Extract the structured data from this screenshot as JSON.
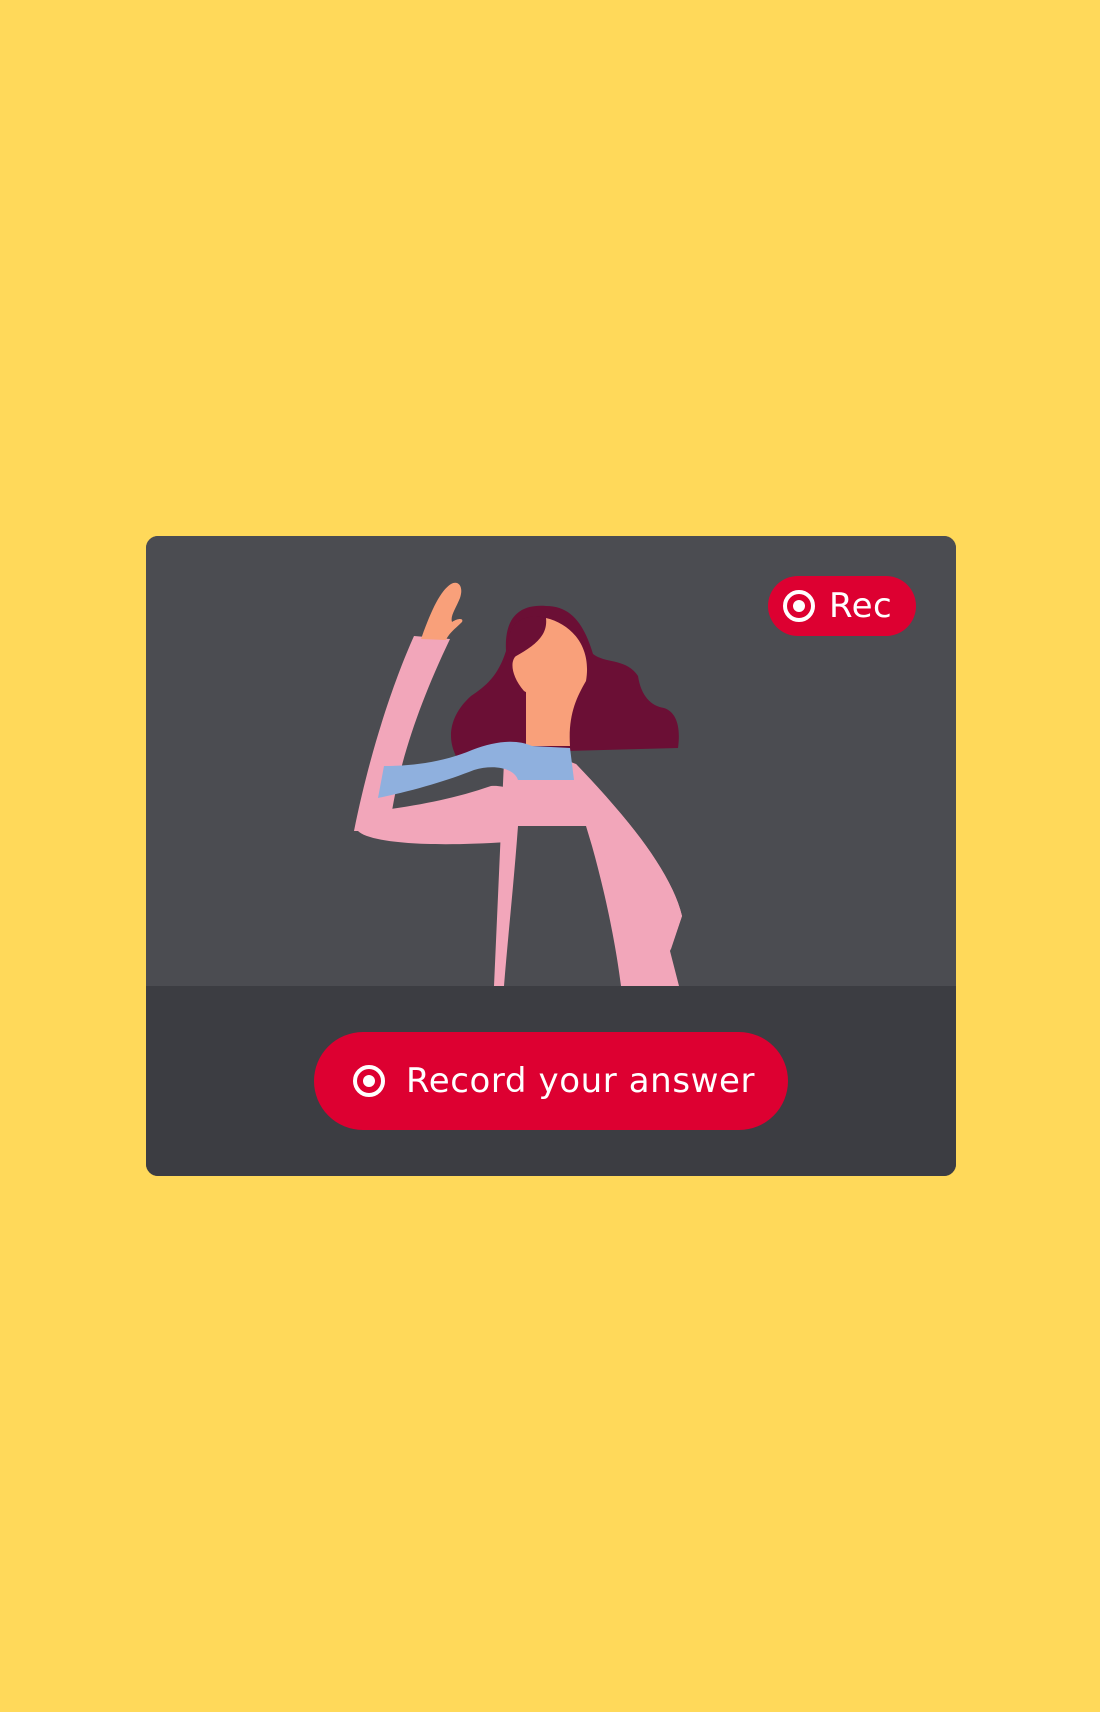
{
  "video_panel": {
    "background": "#4B4C51",
    "illustration": "woman-waving-scarf-illustration",
    "rec_badge": {
      "icon": "record-icon",
      "label": "Rec"
    }
  },
  "controls": {
    "record_button": {
      "icon": "record-icon",
      "label": "Record your answer"
    }
  },
  "colors": {
    "page_background": "#FFD95A",
    "card_background": "#3C3D42",
    "accent_red": "#DD0031",
    "text_white": "#FFFFFF"
  }
}
